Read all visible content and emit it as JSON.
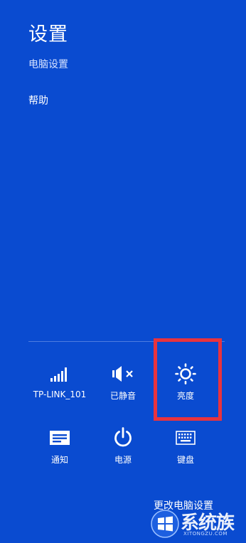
{
  "settings_panel": {
    "title": "设置",
    "pc_settings_link": "电脑设置",
    "help_link": "帮助"
  },
  "quick_settings": [
    {
      "id": "network",
      "icon": "wifi-signal-icon",
      "label": "TP-LINK_101"
    },
    {
      "id": "volume",
      "icon": "volume-muted-icon",
      "label": "已静音"
    },
    {
      "id": "brightness",
      "icon": "brightness-sun-icon",
      "label": "亮度"
    },
    {
      "id": "notifications",
      "icon": "notifications-icon",
      "label": "通知"
    },
    {
      "id": "power",
      "icon": "power-icon",
      "label": "电源"
    },
    {
      "id": "keyboard",
      "icon": "keyboard-icon",
      "label": "键盘"
    }
  ],
  "change_pc_settings": "更改电脑设置",
  "watermark": {
    "text": "系统族",
    "url": "XITONGZU.COM",
    "logo": "windows-logo-icon"
  },
  "colors": {
    "background": "#0a4bd0",
    "highlight_border": "#e8333e",
    "text": "#ffffff"
  }
}
